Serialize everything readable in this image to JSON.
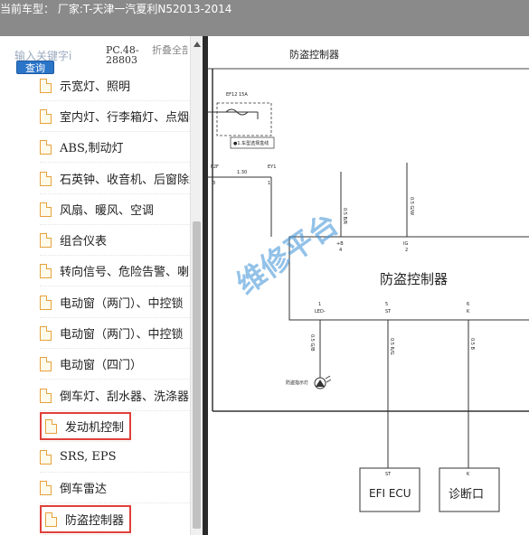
{
  "titlebar": {
    "text": "当前车型： 厂家:T-天津一汽夏利N52013-2014"
  },
  "sidebar": {
    "search_placeholder": "输入关键字i",
    "search_button": "查询",
    "pc_code": "PC.48-28803",
    "fold_all": "折叠全部",
    "items": [
      {
        "label": "示宽灯、照明"
      },
      {
        "label": "室内灯、行李箱灯、点烟器"
      },
      {
        "label": "ABS,制动灯"
      },
      {
        "label": "石英钟、收音机、后窗除霜"
      },
      {
        "label": "风扇、暖风、空调"
      },
      {
        "label": "组合仪表"
      },
      {
        "label": "转向信号、危险告警、喇叭"
      },
      {
        "label": "电动窗（两门）、中控锁"
      },
      {
        "label": "电动窗（两门）、中控锁"
      },
      {
        "label": "电动窗（四门）"
      },
      {
        "label": "倒车灯、刮水器、洗涤器"
      },
      {
        "label": "发动机控制"
      },
      {
        "label": "SRS, EPS"
      },
      {
        "label": "倒车雷达"
      },
      {
        "label": "防盗控制器"
      }
    ]
  },
  "diagram": {
    "header": "防盗控制器",
    "fuse_label": "EF12 15A",
    "note_label": "●1.车型选择盒线",
    "conn_f2f": "F2F",
    "conn_ey1": "EY1",
    "wire_130": "1.30",
    "pin_3": "3",
    "pin_1a": "1",
    "wire_left_color": "0.5 B/R",
    "wire_right_color": "0.5 G/W",
    "top_pin_left_name": "+B",
    "top_pin_left_num": "4",
    "top_pin_right_name": "IG",
    "top_pin_right_num": "2",
    "box_title": "防盗控制器",
    "bot_pin1_num": "1",
    "bot_pin1_name": "LED-",
    "bot_pin2_num": "5",
    "bot_pin2_name": "ST",
    "bot_pin3_num": "6",
    "bot_pin3_name": "K",
    "wire_b1": "0.5 G/B",
    "wire_b2": "0.5 R/G",
    "wire_b3": "0.5 B",
    "led_label": "防盗指示灯",
    "ecu_pin": "ST",
    "ecu_label": "EFI ECU",
    "diag_pin": "K",
    "diag_label": "诊断口",
    "watermark": "维修平台"
  }
}
